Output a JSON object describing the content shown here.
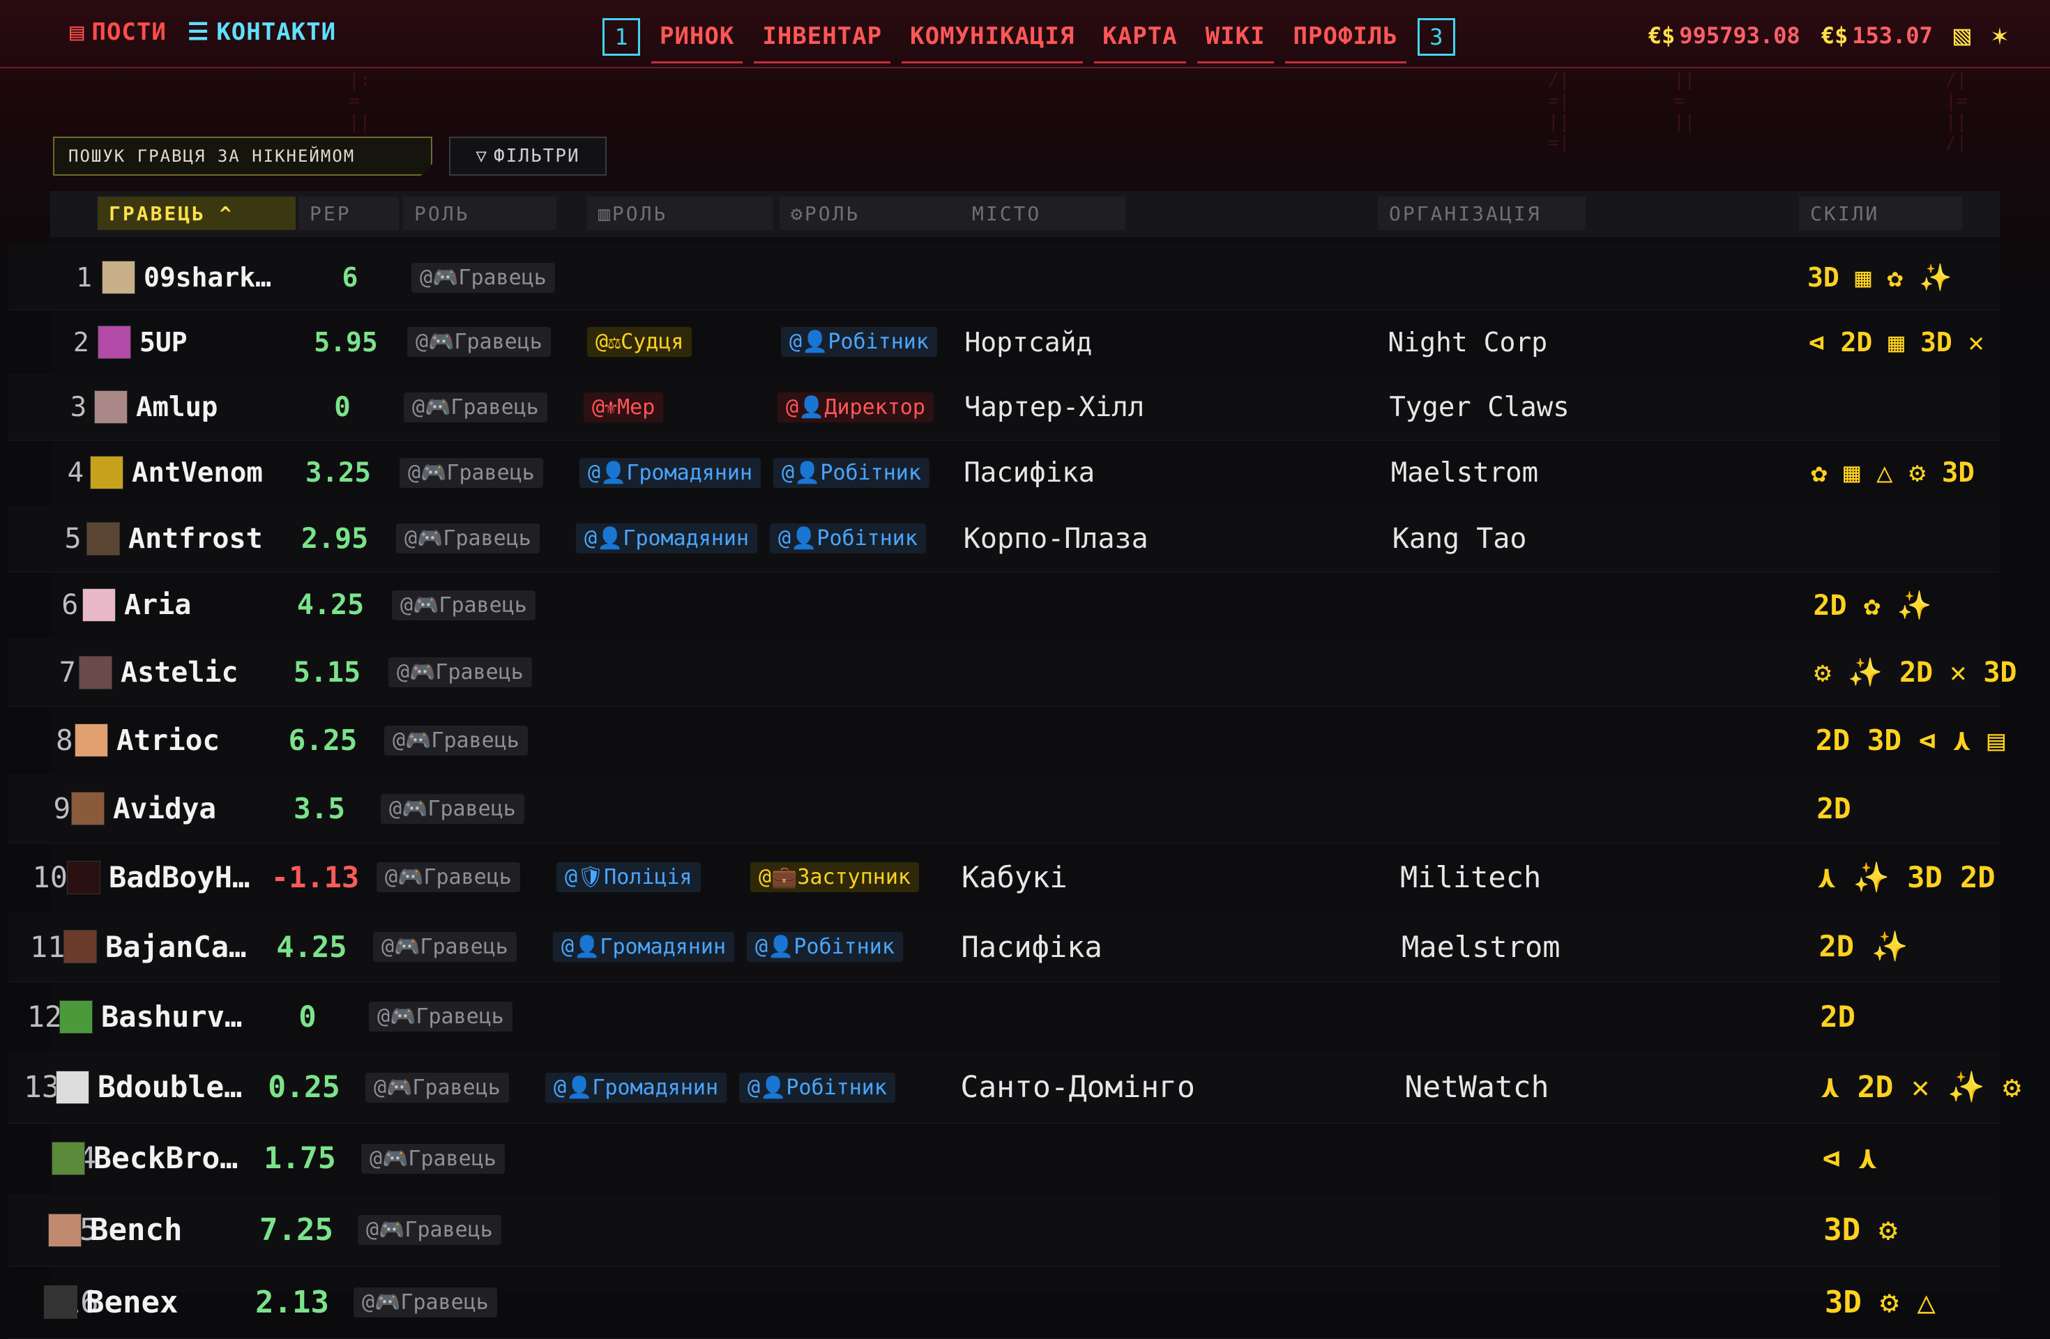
{
  "nav": {
    "posts": "ПОСТИ",
    "contacts": "КОНТАКТИ",
    "hotkey_left": "1",
    "hotkey_right": "3",
    "links": [
      "РИНОК",
      "ІНВЕНТАР",
      "КОМУНІКАЦІЯ",
      "КАРТА",
      "WIKI",
      "ПРОФІЛЬ"
    ],
    "currency_symbol": "€$",
    "balance_1": "995793.08",
    "balance_2": "153.07"
  },
  "search": {
    "placeholder": "ПОШУК ГРАВЦЯ ЗА НІКНЕЙМОМ"
  },
  "filters_label": "ФІЛЬТРИ",
  "columns": {
    "player": "ГРАВЕЦЬ",
    "rep": "РЕР",
    "role": "РОЛЬ",
    "role2": "РОЛЬ",
    "role3": "РОЛЬ",
    "city": "МІСТО",
    "org": "ОРГАНІЗАЦІЯ",
    "skills": "СКІЛИ"
  },
  "colors": {
    "accent_red": "#ff5757",
    "accent_cyan": "#3fd6f0",
    "accent_yellow": "#ffe04a",
    "rep_positive": "#7be38a",
    "rep_negative": "#ff5a5a"
  },
  "rows": [
    {
      "n": "1",
      "name": "09shark…",
      "rep": "6",
      "role": "@🎮Гравець",
      "r2": "",
      "r2c": "",
      "r3": "",
      "r3c": "",
      "city": "",
      "org": "",
      "skills": "3D ▦ ✿ ✨",
      "av": "#c9b08a"
    },
    {
      "n": "2",
      "name": "5UP",
      "rep": "5.95",
      "role": "@🎮Гравець",
      "r2": "@⚖Судця",
      "r2c": "yellow",
      "r3": "@👤Робітник",
      "r3c": "blue",
      "city": "Нортсайд",
      "org": "Night Corp",
      "skills": "⊲ 2D ▦ 3D ✕",
      "av": "#b24aa8"
    },
    {
      "n": "3",
      "name": "Amlup",
      "rep": "0",
      "role": "@🎮Гравець",
      "r2": "@⚜Мер",
      "r2c": "red",
      "r3": "@👤Директор",
      "r3c": "red",
      "city": "Чартер-Хілл",
      "org": "Tyger Claws",
      "skills": "",
      "av": "#a88"
    },
    {
      "n": "4",
      "name": "AntVenom",
      "rep": "3.25",
      "role": "@🎮Гравець",
      "r2": "@👤Громадянин",
      "r2c": "blue",
      "r3": "@👤Робітник",
      "r3c": "blue",
      "city": "Пасифіка",
      "org": "Maelstrom",
      "skills": "✿ ▦ △ ⚙ 3D",
      "av": "#c7a21c"
    },
    {
      "n": "5",
      "name": "Antfrost",
      "rep": "2.95",
      "role": "@🎮Гравець",
      "r2": "@👤Громадянин",
      "r2c": "blue",
      "r3": "@👤Робітник",
      "r3c": "blue",
      "city": "Корпо-Плаза",
      "org": "Kang Tao",
      "skills": "",
      "av": "#5a4632"
    },
    {
      "n": "6",
      "name": "Aria",
      "rep": "4.25",
      "role": "@🎮Гравець",
      "r2": "",
      "r2c": "",
      "r3": "",
      "r3c": "",
      "city": "",
      "org": "",
      "skills": "2D ✿ ✨",
      "av": "#e8b8c8"
    },
    {
      "n": "7",
      "name": "Astelic",
      "rep": "5.15",
      "role": "@🎮Гравець",
      "r2": "",
      "r2c": "",
      "r3": "",
      "r3c": "",
      "city": "",
      "org": "",
      "skills": "⚙ ✨ 2D ✕ 3D",
      "av": "#6a4a4a"
    },
    {
      "n": "8",
      "name": "Atrioc",
      "rep": "6.25",
      "role": "@🎮Гравець",
      "r2": "",
      "r2c": "",
      "r3": "",
      "r3c": "",
      "city": "",
      "org": "",
      "skills": "2D 3D ⊲ ⋏ ▤",
      "av": "#e0a070"
    },
    {
      "n": "9",
      "name": "Avidya",
      "rep": "3.5",
      "role": "@🎮Гравець",
      "r2": "",
      "r2c": "",
      "r3": "",
      "r3c": "",
      "city": "",
      "org": "",
      "skills": "2D",
      "av": "#8a5a3a"
    },
    {
      "n": "10",
      "name": "BadBoyH…",
      "rep": "-1.13",
      "role": "@🎮Гравець",
      "r2": "@🛡Поліція",
      "r2c": "blue",
      "r3": "@💼Заступник",
      "r3c": "yellow",
      "city": "Кабукі",
      "org": "Militech",
      "skills": "⋏ ✨ 3D 2D",
      "av": "#2a1010"
    },
    {
      "n": "11",
      "name": "BajanCa…",
      "rep": "4.25",
      "role": "@🎮Гравець",
      "r2": "@👤Громадянин",
      "r2c": "blue",
      "r3": "@👤Робітник",
      "r3c": "blue",
      "city": "Пасифіка",
      "org": "Maelstrom",
      "skills": "2D ✨",
      "av": "#6a3a2a"
    },
    {
      "n": "12",
      "name": "Bashurv…",
      "rep": "0",
      "role": "@🎮Гравець",
      "r2": "",
      "r2c": "",
      "r3": "",
      "r3c": "",
      "city": "",
      "org": "",
      "skills": "2D",
      "av": "#4a9a3a"
    },
    {
      "n": "13",
      "name": "Bdouble…",
      "rep": "0.25",
      "role": "@🎮Гравець",
      "r2": "@👤Громадянин",
      "r2c": "blue",
      "r3": "@👤Робітник",
      "r3c": "blue",
      "city": "Санто-Домінго",
      "org": "NetWatch",
      "skills": "⋏ 2D ✕ ✨ ⚙",
      "av": "#ddd"
    },
    {
      "n": "14",
      "name": "BeckBro…",
      "rep": "1.75",
      "role": "@🎮Гравець",
      "r2": "",
      "r2c": "",
      "r3": "",
      "r3c": "",
      "city": "",
      "org": "",
      "skills": "⊲ ⋏",
      "av": "#5a8a3a"
    },
    {
      "n": "15",
      "name": "Bench",
      "rep": "7.25",
      "role": "@🎮Гравець",
      "r2": "",
      "r2c": "",
      "r3": "",
      "r3c": "",
      "city": "",
      "org": "",
      "skills": "3D ⚙",
      "av": "#c08a70"
    },
    {
      "n": "16",
      "name": "Benex",
      "rep": "2.13",
      "role": "@🎮Гравець",
      "r2": "",
      "r2c": "",
      "r3": "",
      "r3c": "",
      "city": "",
      "org": "",
      "skills": "3D ⚙ △",
      "av": "#333"
    }
  ]
}
